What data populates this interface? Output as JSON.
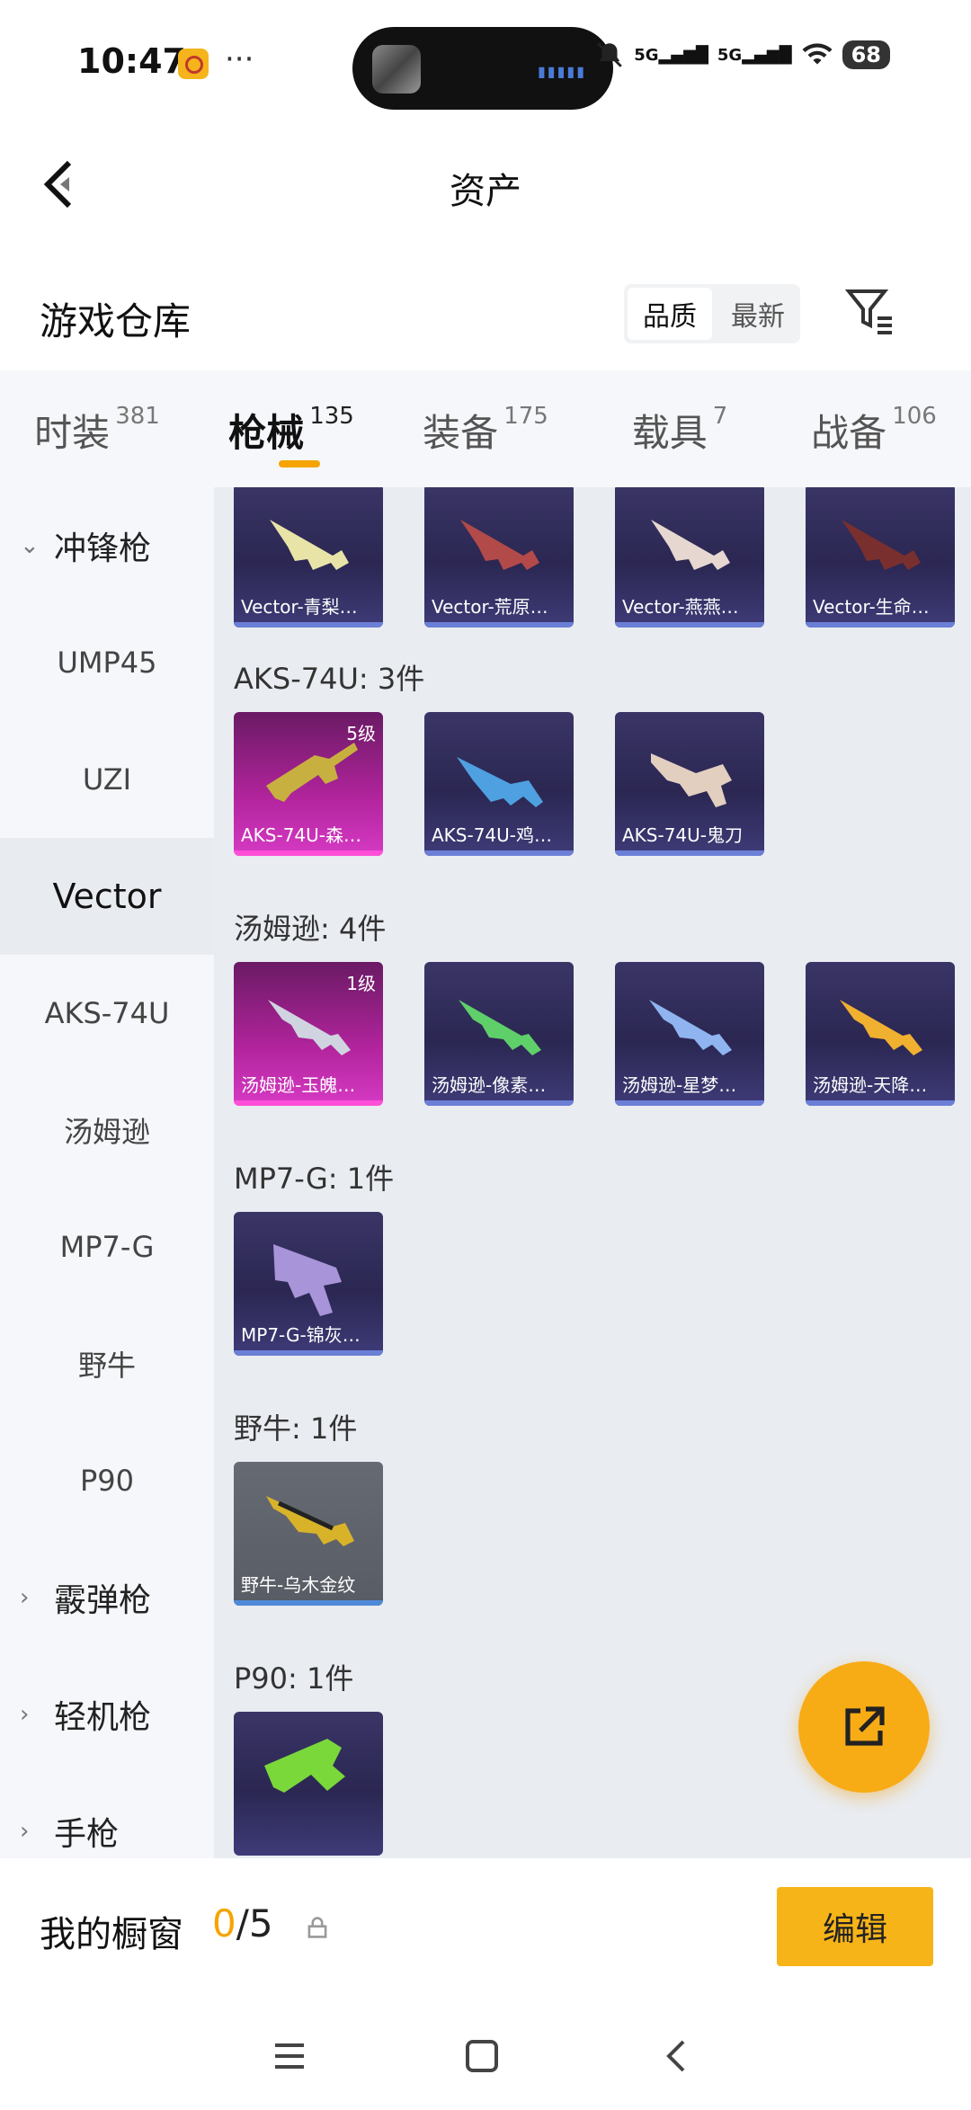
{
  "status_bar": {
    "time": "10:47",
    "dots": "···",
    "network_1": "5G",
    "network_2": "5G",
    "battery": "68"
  },
  "nav": {
    "title": "资产"
  },
  "warehouse": {
    "title": "游戏仓库",
    "sort_options": [
      "品质",
      "最新"
    ],
    "sort_selected": "品质"
  },
  "tabs": [
    {
      "label": "时装",
      "count": "381"
    },
    {
      "label": "枪械",
      "count": "135",
      "active": true
    },
    {
      "label": "装备",
      "count": "175"
    },
    {
      "label": "载具",
      "count": "7"
    },
    {
      "label": "战备",
      "count": "106"
    }
  ],
  "sidebar": {
    "group_open": "冲锋枪",
    "items": [
      "UMP45",
      "UZI",
      "Vector",
      "AKS-74U",
      "汤姆逊",
      "MP7-G",
      "野牛",
      "P90"
    ],
    "selected": "Vector",
    "groups_closed": [
      "霰弹枪",
      "轻机枪",
      "手枪"
    ]
  },
  "content": {
    "vector_cards": [
      "Vector-青梨…",
      "Vector-荒原…",
      "Vector-燕燕…",
      "Vector-生命…"
    ],
    "aks_title": "AKS-74U: 3件",
    "aks_cards": [
      {
        "label": "AKS-74U-森…",
        "level": "5级"
      },
      {
        "label": "AKS-74U-鸡…"
      },
      {
        "label": "AKS-74U-鬼刀"
      }
    ],
    "tommy_title": "汤姆逊: 4件",
    "tommy_cards": [
      {
        "label": "汤姆逊-玉魄…",
        "level": "1级"
      },
      {
        "label": "汤姆逊-像素…"
      },
      {
        "label": "汤姆逊-星梦…"
      },
      {
        "label": "汤姆逊-天降…"
      }
    ],
    "mp7_title": "MP7-G: 1件",
    "mp7_cards": [
      "MP7-G-锦灰…"
    ],
    "bison_title": "野牛: 1件",
    "bison_cards": [
      "野牛-乌木金纹"
    ],
    "p90_title": "P90: 1件"
  },
  "bottom": {
    "showcase_label": "我的橱窗",
    "showcase_current": "0",
    "showcase_total": "/5",
    "edit_label": "编辑"
  },
  "colors": {
    "accent": "#f7b418",
    "page_bg": "#e9ecf1"
  }
}
